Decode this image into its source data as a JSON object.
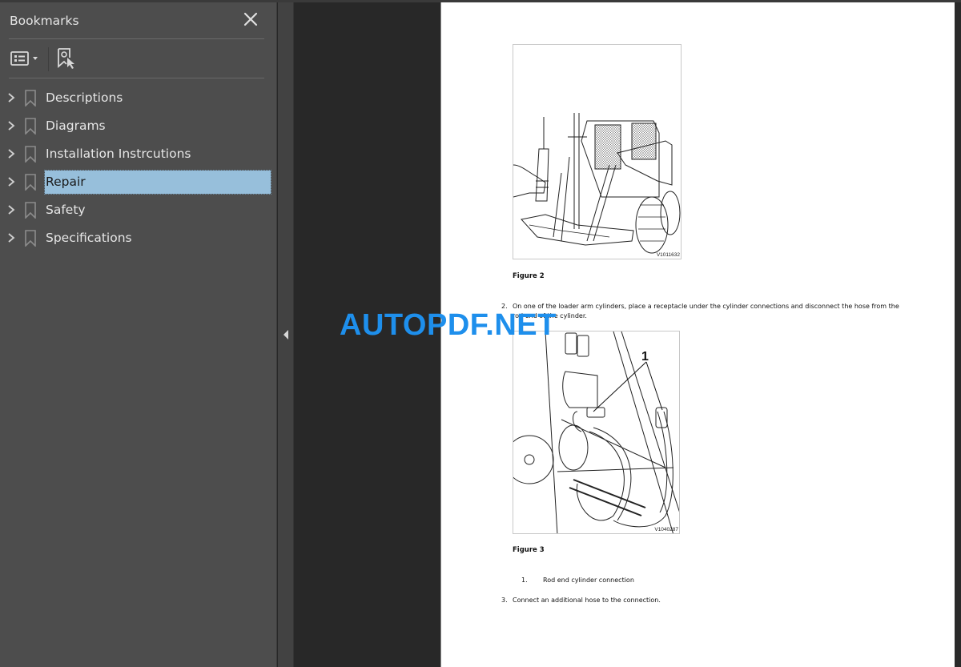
{
  "bookmarks_panel": {
    "title": "Bookmarks",
    "close_icon": "close-icon",
    "toolbar": {
      "options_icon": "list-options-icon",
      "options_dropdown_icon": "caret-down-icon",
      "find_bookmark_icon": "find-current-bookmark-icon"
    },
    "items": [
      {
        "label": "Descriptions",
        "selected": false
      },
      {
        "label": "Diagrams",
        "selected": false
      },
      {
        "label": "Installation Instrcutions",
        "selected": false
      },
      {
        "label": "Repair",
        "selected": true
      },
      {
        "label": "Safety",
        "selected": false
      },
      {
        "label": "Specifications",
        "selected": false
      }
    ]
  },
  "splitter": {
    "collapse_icon": "collapse-left-icon"
  },
  "document": {
    "figures": [
      {
        "caption": "Figure 2",
        "code": "V1011632",
        "depicts": "skid steer loader with hand lamp"
      },
      {
        "caption": "Figure 3",
        "code": "V1040287",
        "depicts": "loader arm cylinder hose connection",
        "callout": "1"
      }
    ],
    "steps": [
      {
        "number": "2.",
        "text_line1": "On one of the loader arm cylinders, place a receptacle under the cylinder connections and disconnect the hose from the",
        "text_line2": "rod end of the cylinder."
      },
      {
        "number": "3.",
        "text_line1": "Connect an additional hose to the connection."
      }
    ],
    "legend": [
      {
        "number": "1.",
        "text": "Rod end cylinder connection"
      }
    ]
  },
  "watermark": "AUTOPDF.NET",
  "colors": {
    "panel_bg": "#4d4d4d",
    "selection": "#97bfdb",
    "doc_bg": "#282828",
    "watermark": "#1e8fec"
  }
}
